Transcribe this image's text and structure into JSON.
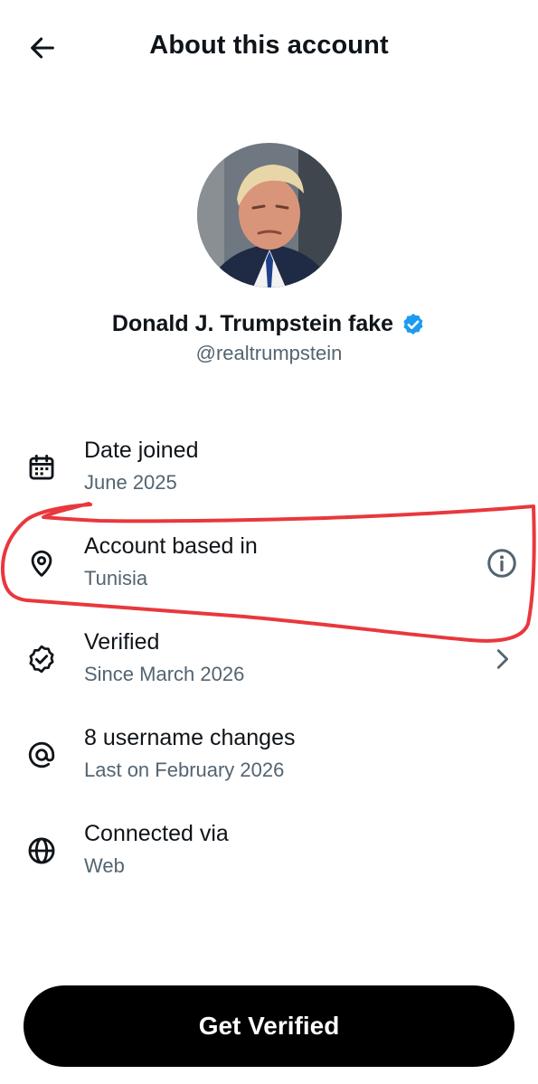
{
  "header": {
    "title": "About this account",
    "back_icon": "arrow-left-icon"
  },
  "profile": {
    "display_name": "Donald J. Trumpstein fake",
    "handle": "@realtrumpstein",
    "verified": true,
    "badge_color": "#1d9bf0"
  },
  "details": [
    {
      "icon": "calendar-icon",
      "label": "Date joined",
      "value": "June 2025"
    },
    {
      "icon": "location-pin-icon",
      "label": "Account based in",
      "value": "Tunisia",
      "action_icon": "info-icon"
    },
    {
      "icon": "verified-badge-icon",
      "label": "Verified",
      "value": "Since March 2026",
      "action_icon": "chevron-right-icon"
    },
    {
      "icon": "at-sign-icon",
      "label": "8 username changes",
      "value": "Last on February 2026"
    },
    {
      "icon": "globe-icon",
      "label": "Connected via",
      "value": "Web"
    }
  ],
  "annotation": {
    "type": "hand-drawn-outline",
    "color": "#e8383d",
    "highlights": "Account based in"
  },
  "footer": {
    "cta_label": "Get Verified"
  },
  "colors": {
    "text_primary": "#0f1419",
    "text_secondary": "#536471",
    "cta_background": "#000000"
  }
}
